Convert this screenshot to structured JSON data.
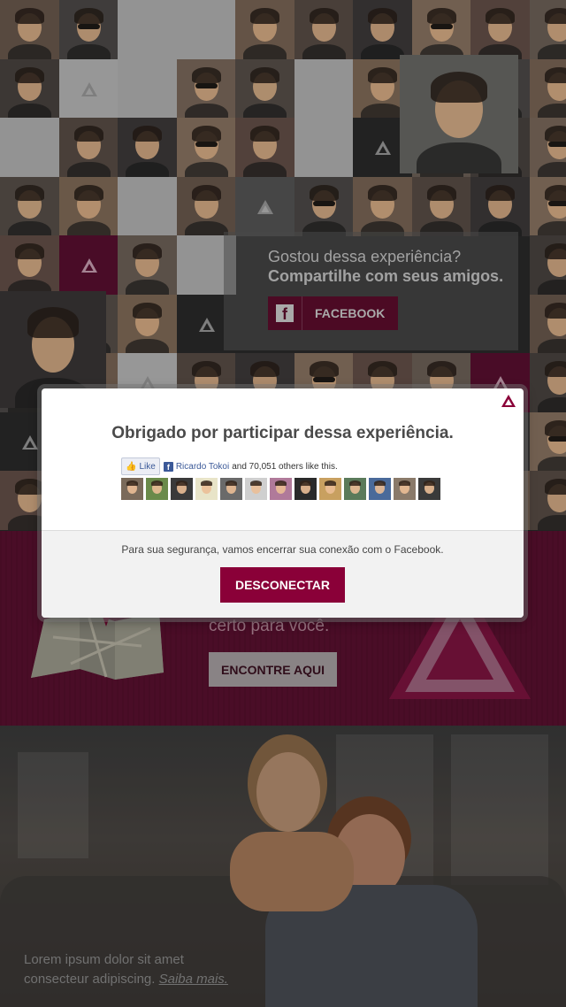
{
  "share": {
    "question": "Gostou dessa experiência?",
    "subtitle": "Compartilhe com seus amigos.",
    "facebook_button": "FACEBOOK",
    "facebook_icon": "f"
  },
  "promo": {
    "text": "certo para você.",
    "button": "ENCONTRE AQUI"
  },
  "hero": {
    "line1": "Lorem ipsum dolor sit amet",
    "line2": "consecteur adipiscing.",
    "more_link": "Saiba mais."
  },
  "modal": {
    "title": "Obrigado por participar dessa experiência.",
    "like_button": "Like",
    "like_name": "Ricardo Tokoi",
    "like_rest": "and 70,051 others like this.",
    "friend_count": 13,
    "security_text": "Para sua segurança, vamos encerrar sua conexão com o Facebook.",
    "disconnect_button": "DESCONECTAR"
  },
  "colors": {
    "brand": "#8a0038",
    "brand_dark": "#5d0d2c",
    "facebook": "#3b5998"
  },
  "icons": {
    "logo": "triangle-logo-icon",
    "facebook": "facebook-icon",
    "like": "thumbs-up-icon"
  }
}
